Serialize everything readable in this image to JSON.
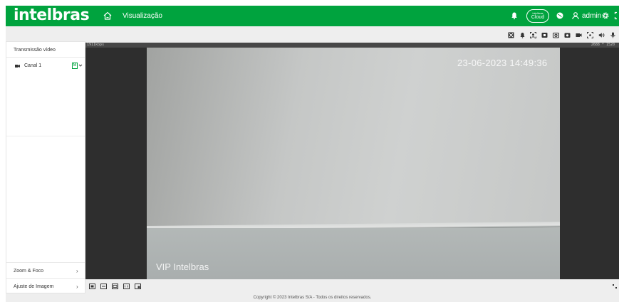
{
  "header": {
    "logo": "intelbras",
    "nav_label": "Visualização",
    "cloud_small": "intelbras",
    "cloud_label": "Cloud",
    "username": "admin",
    "brand_color": "#00a33e"
  },
  "left_panel": {
    "title": "Transmissão vídeo",
    "channel": {
      "label": "Canal 1",
      "stream_badge": "M"
    },
    "zoom_focus": "Zoom & Foco",
    "image_adjust": "Ajuste de Imagem",
    "arrow": "›"
  },
  "toolbar": {
    "icons": [
      "clear-alarm-icon",
      "alarm-icon",
      "face-detection-icon",
      "image-adjust-icon",
      "snapshot-icon",
      "continuous-snapshot-icon",
      "record-icon",
      "digital-zoom-icon",
      "audio-icon",
      "talk-icon"
    ]
  },
  "video": {
    "bitrate": "1911kbps",
    "resolution": "2688 * 1520",
    "osd_timestamp": "23-06-2023 14:49:36",
    "osd_channel_name": "VIP Intelbras"
  },
  "bottom_bar": {
    "icons": [
      "original-size-icon",
      "fit-window-icon",
      "ratio-16-9-icon",
      "ratio-4-3-icon",
      "pip-icon",
      "expand-icon"
    ]
  },
  "footer": {
    "copyright": "Copyright © 2023 Intelbras S/A - Todos os direitos reservados."
  }
}
